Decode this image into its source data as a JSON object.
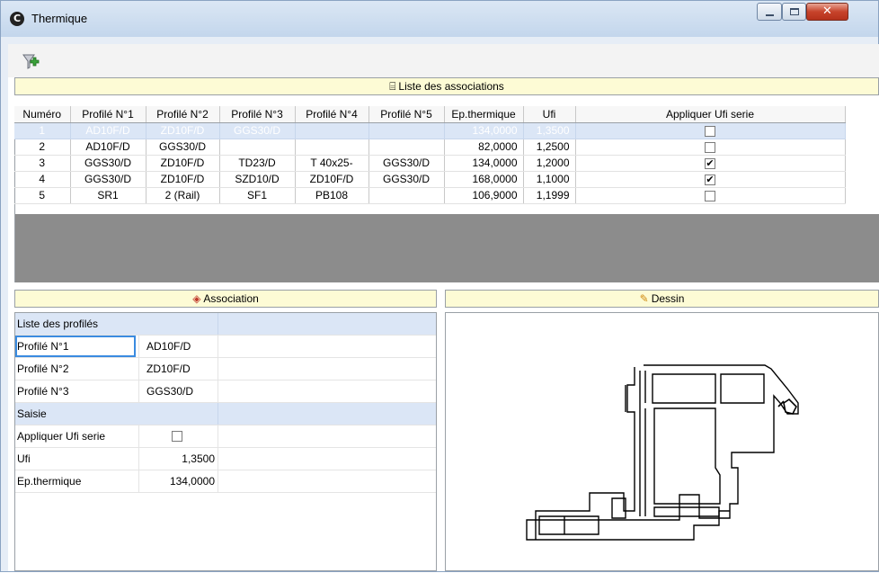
{
  "window": {
    "title": "Thermique"
  },
  "toolbar": {
    "filter_icon": "filter-add-icon"
  },
  "liste": {
    "header": "Liste des associations",
    "columns": [
      "Numéro",
      "Profilé N°1",
      "Profilé N°2",
      "Profilé N°3",
      "Profilé N°4",
      "Profilé N°5",
      "Ep.thermique",
      "Ufi",
      "Appliquer Ufi serie"
    ],
    "rows": [
      {
        "num": "1",
        "p1": "AD10F/D",
        "p2": "ZD10F/D",
        "p3": "GGS30/D",
        "p4": "",
        "p5": "",
        "ep": "134,0000",
        "ufi": "1,3500",
        "apply": false,
        "selected": true
      },
      {
        "num": "2",
        "p1": "AD10F/D",
        "p2": "GGS30/D",
        "p3": "",
        "p4": "",
        "p5": "",
        "ep": "82,0000",
        "ufi": "1,2500",
        "apply": false,
        "selected": false
      },
      {
        "num": "3",
        "p1": "GGS30/D",
        "p2": "ZD10F/D",
        "p3": "TD23/D",
        "p4": "T 40x25-",
        "p5": "GGS30/D",
        "ep": "134,0000",
        "ufi": "1,2000",
        "apply": true,
        "selected": false
      },
      {
        "num": "4",
        "p1": "GGS30/D",
        "p2": "ZD10F/D",
        "p3": "SZD10/D",
        "p4": "ZD10F/D",
        "p5": "GGS30/D",
        "ep": "168,0000",
        "ufi": "1,1000",
        "apply": true,
        "selected": false
      },
      {
        "num": "5",
        "p1": "SR1",
        "p2": "2 (Rail)",
        "p3": "SF1",
        "p4": "PB108",
        "p5": "",
        "ep": "106,9000",
        "ufi": "1,1999",
        "apply": false,
        "selected": false
      }
    ]
  },
  "association": {
    "header": "Association",
    "cat_profiles": "Liste des profilés",
    "profiles": [
      {
        "label": "Profilé N°1",
        "value": "AD10F/D"
      },
      {
        "label": "Profilé N°2",
        "value": "ZD10F/D"
      },
      {
        "label": "Profilé N°3",
        "value": "GGS30/D"
      }
    ],
    "cat_saisie": "Saisie",
    "apply_label": "Appliquer Ufi serie",
    "apply_value": false,
    "ufi_label": "Ufi",
    "ufi_value": "1,3500",
    "ep_label": "Ep.thermique",
    "ep_value": "134,0000"
  },
  "dessin": {
    "header": "Dessin"
  }
}
